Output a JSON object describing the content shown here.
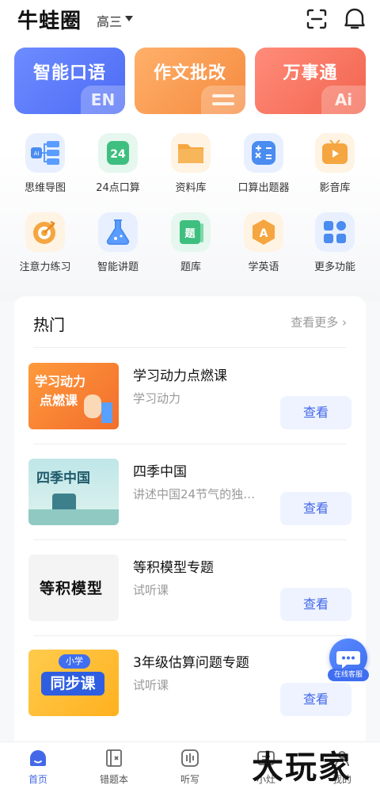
{
  "header": {
    "app_title": "牛蛙圈",
    "grade": "高三",
    "scan_icon": "scan-icon",
    "bell_icon": "notification-icon"
  },
  "feature_cards": [
    {
      "label": "智能口语",
      "badge": "EN",
      "color": "#5b7cfa"
    },
    {
      "label": "作文批改",
      "badge": "",
      "color": "#f79a4c"
    },
    {
      "label": "万事通",
      "badge": "Ai",
      "color": "#f47560"
    }
  ],
  "tools": [
    {
      "label": "思维导图",
      "icon": "mindmap-icon",
      "color": "#5b8cff"
    },
    {
      "label": "24点口算",
      "icon": "twenty-four-icon",
      "color": "#3fbf7f"
    },
    {
      "label": "资料库",
      "icon": "folder-icon",
      "color": "#f5a640"
    },
    {
      "label": "口算出题器",
      "icon": "calculator-icon",
      "color": "#4a8cf0"
    },
    {
      "label": "影音库",
      "icon": "video-icon",
      "color": "#f5a640"
    },
    {
      "label": "注意力练习",
      "icon": "target-icon",
      "color": "#f5a640"
    },
    {
      "label": "智能讲题",
      "icon": "flask-icon",
      "color": "#4a8cf0"
    },
    {
      "label": "题库",
      "icon": "question-bank-icon",
      "color": "#3fbf7f"
    },
    {
      "label": "学英语",
      "icon": "english-icon",
      "color": "#f5a640"
    },
    {
      "label": "更多功能",
      "icon": "more-apps-icon",
      "color": "#4a8cf0"
    }
  ],
  "hot": {
    "title": "热门",
    "more": "查看更多",
    "courses": [
      {
        "title": "学习动力点燃课",
        "subtitle": "学习动力",
        "button": "查看",
        "thumb_text1": "学习动力",
        "thumb_text2": "点燃课"
      },
      {
        "title": "四季中国",
        "subtitle": "讲述中国24节气的独…",
        "button": "查看",
        "thumb_text1": "四季中国",
        "thumb_text2": ""
      },
      {
        "title": "等积模型专题",
        "subtitle": "试听课",
        "button": "查看",
        "thumb_text1": "等积模型",
        "thumb_text2": ""
      },
      {
        "title": "3年级估算问题专题",
        "subtitle": "试听课",
        "button": "查看",
        "thumb_text1": "小学",
        "thumb_text2": "同步课"
      }
    ]
  },
  "service": {
    "label": "在线客服"
  },
  "nav": [
    {
      "label": "首页",
      "icon": "home-icon",
      "active": true
    },
    {
      "label": "错题本",
      "icon": "mistake-book-icon",
      "active": false
    },
    {
      "label": "听写",
      "icon": "dictation-icon",
      "active": false
    },
    {
      "label": "小灶",
      "icon": "class-icon",
      "active": false
    },
    {
      "label": "我的",
      "icon": "profile-icon",
      "active": false
    }
  ],
  "watermark": "大玩家",
  "accent": "#4468e8"
}
